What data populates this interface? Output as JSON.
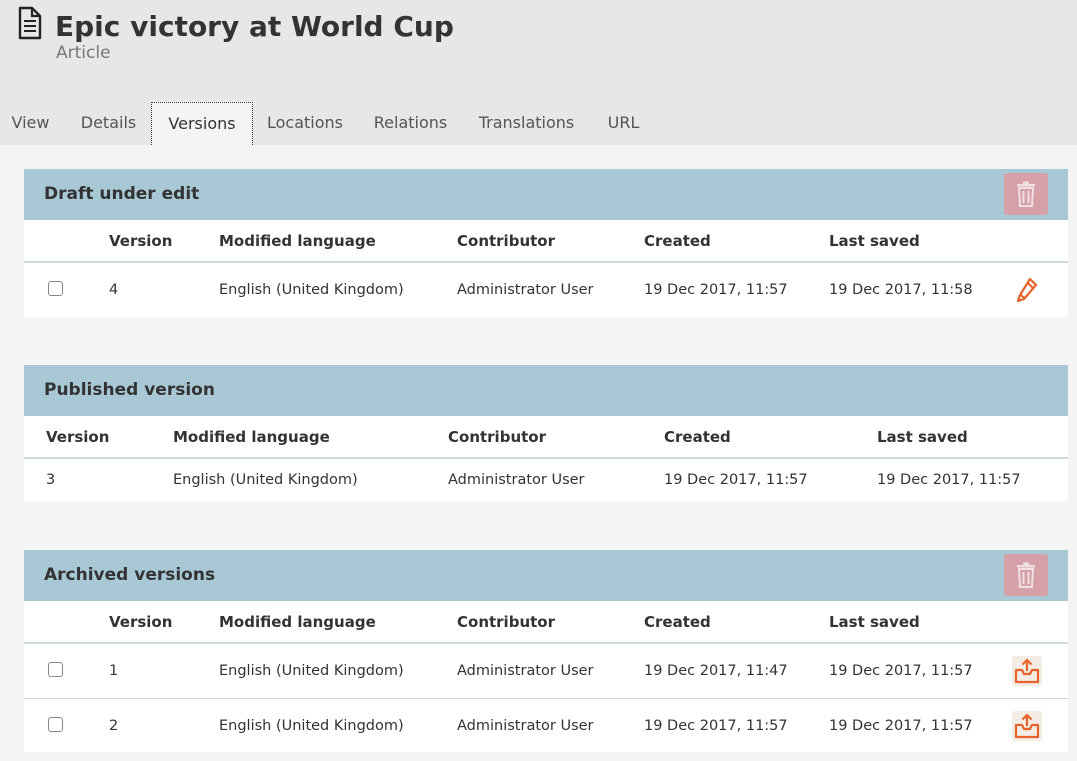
{
  "header": {
    "title": "Epic victory at World Cup",
    "subtitle": "Article",
    "icon": "document-icon"
  },
  "tabs": [
    {
      "label": "View"
    },
    {
      "label": "Details"
    },
    {
      "label": "Versions",
      "active": true
    },
    {
      "label": "Locations"
    },
    {
      "label": "Relations"
    },
    {
      "label": "Translations"
    },
    {
      "label": "URL"
    }
  ],
  "colors": {
    "accent": "#e8632b",
    "panel_header": "#a9c8d5",
    "trash_button": "#d6a0a8"
  },
  "draft": {
    "title": "Draft under edit",
    "columns": [
      "Version",
      "Modified language",
      "Contributor",
      "Created",
      "Last saved"
    ],
    "rows": [
      {
        "version": "4",
        "language": "English (United Kingdom)",
        "contributor": "Administrator User",
        "created": "19 Dec 2017, 11:57",
        "saved": "19 Dec 2017, 11:58"
      }
    ]
  },
  "published": {
    "title": "Published version",
    "columns": [
      "Version",
      "Modified language",
      "Contributor",
      "Created",
      "Last saved"
    ],
    "rows": [
      {
        "version": "3",
        "language": "English (United Kingdom)",
        "contributor": "Administrator User",
        "created": "19 Dec 2017, 11:57",
        "saved": "19 Dec 2017, 11:57"
      }
    ]
  },
  "archived": {
    "title": "Archived versions",
    "columns": [
      "Version",
      "Modified language",
      "Contributor",
      "Created",
      "Last saved"
    ],
    "rows": [
      {
        "version": "1",
        "language": "English (United Kingdom)",
        "contributor": "Administrator User",
        "created": "19 Dec 2017, 11:47",
        "saved": "19 Dec 2017, 11:57"
      },
      {
        "version": "2",
        "language": "English (United Kingdom)",
        "contributor": "Administrator User",
        "created": "19 Dec 2017, 11:57",
        "saved": "19 Dec 2017, 11:57"
      }
    ]
  }
}
